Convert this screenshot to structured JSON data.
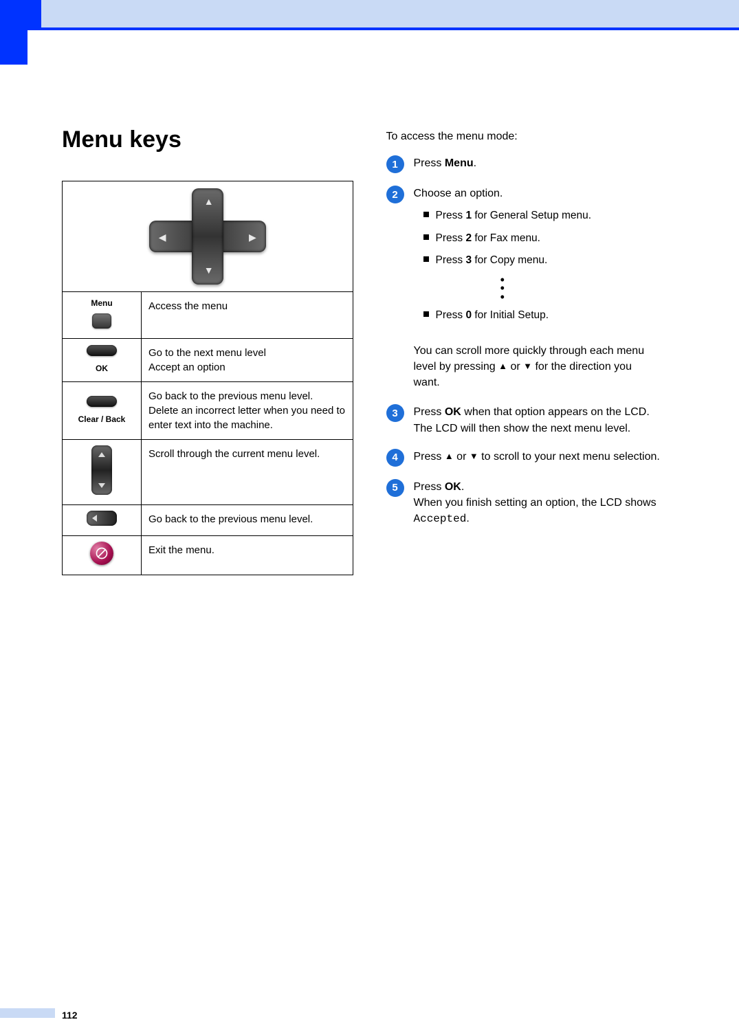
{
  "page_number": "112",
  "title": "Menu keys",
  "table": {
    "rows": [
      {
        "label": "Menu",
        "desc": "Access the menu"
      },
      {
        "label": "OK",
        "desc": "Go to the next menu level\nAccept an option"
      },
      {
        "label": "Clear / Back",
        "desc": "Go back to the previous menu level.\nDelete an incorrect letter when you need to enter text into the machine."
      },
      {
        "label": "",
        "desc": "Scroll through the current menu level."
      },
      {
        "label": "",
        "desc": "Go back to the previous menu level."
      },
      {
        "label": "",
        "desc": "Exit the menu."
      }
    ]
  },
  "intro": "To access the menu mode:",
  "steps": {
    "s1_prefix": "Press ",
    "s1_bold": "Menu",
    "s1_suffix": ".",
    "s2_text": "Choose an option.",
    "s2_bullets": {
      "b1_pre": "Press ",
      "b1_b": "1",
      "b1_post": " for General Setup menu.",
      "b2_pre": "Press ",
      "b2_b": "2",
      "b2_post": " for Fax menu.",
      "b3_pre": "Press ",
      "b3_b": "3",
      "b3_post": " for Copy menu.",
      "b4_pre": "Press ",
      "b4_b": "0",
      "b4_post": " for Initial Setup."
    },
    "scroll_pre": "You can scroll more quickly through each menu level by pressing ",
    "scroll_mid": " or ",
    "scroll_post": " for the direction you want.",
    "s3_pre": "Press ",
    "s3_b": "OK",
    "s3_mid": " when that option appears on the LCD.",
    "s3_post": "The LCD will then show the next menu level.",
    "s4_pre": "Press ",
    "s4_mid": " or ",
    "s4_post": " to scroll to your next menu selection.",
    "s5_pre": "Press ",
    "s5_b": "OK",
    "s5_suffix": ".",
    "s5_line2_pre": "When you finish setting an option, the LCD shows ",
    "s5_code": "Accepted",
    "s5_line2_post": "."
  },
  "glyphs": {
    "up": "▲",
    "down": "▼",
    "left": "◀",
    "right": "▶"
  }
}
